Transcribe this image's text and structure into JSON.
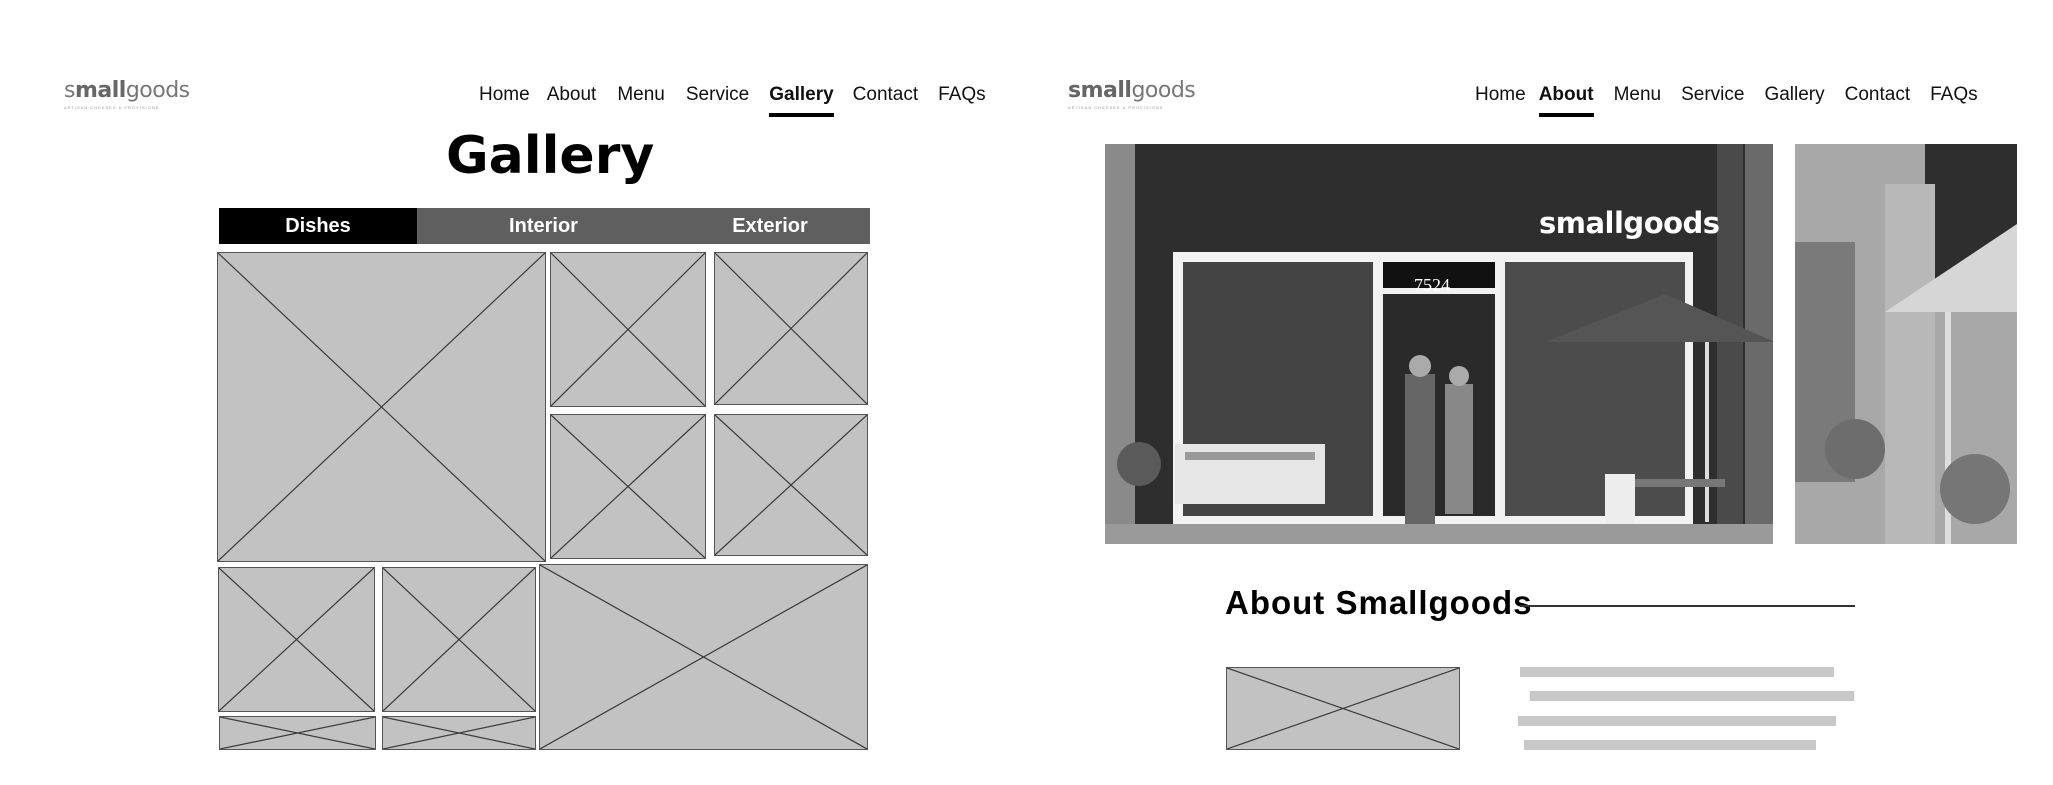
{
  "gallery_page": {
    "logo": {
      "brand_prefix": "s",
      "brand_bold": "mall",
      "brand_rest": "goods",
      "tagline": "ARTISAN CHEESES & PROVISIONS"
    },
    "nav": [
      "Home",
      "About",
      "Menu",
      "Service",
      "Gallery",
      "Contact",
      "FAQs"
    ],
    "active_nav": "Gallery",
    "title": "Gallery",
    "tabs": [
      "Dishes",
      "Interior",
      "Exterior"
    ],
    "active_tab": "Dishes"
  },
  "about_page": {
    "logo": {
      "brand_bold": "small",
      "brand_rest": "goods",
      "tagline": "ARTISAN CHEESES & PROVISIONS"
    },
    "nav": [
      "Home",
      "About",
      "Menu",
      "Service",
      "Gallery",
      "Contact",
      "FAQs"
    ],
    "active_nav": "About",
    "storefront": {
      "sign": "smallgoods",
      "address_number": "7524"
    },
    "heading": "About Smallgoods"
  },
  "colors": {
    "placeholder": "#c2c2c2",
    "tab_bar": "#5f5f5f",
    "tab_active": "#000000",
    "text_line": "#c8c8c8"
  }
}
